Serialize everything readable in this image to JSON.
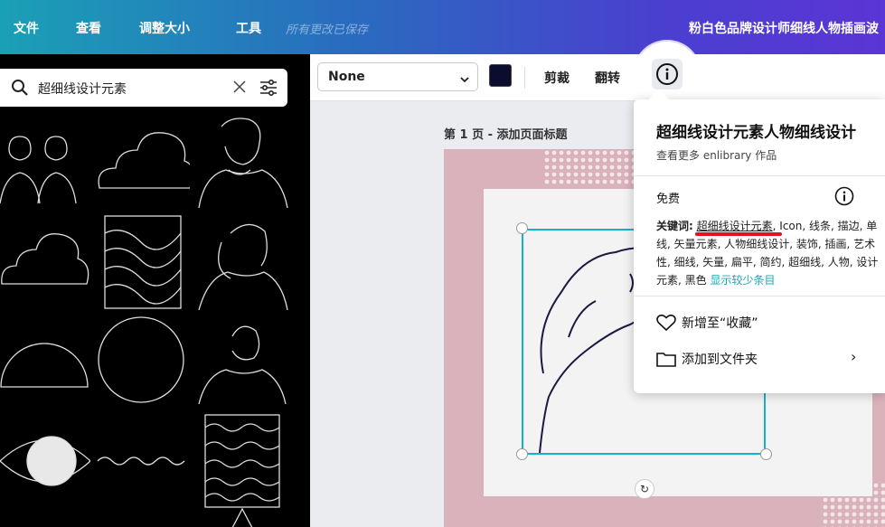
{
  "topbar": {
    "menu": [
      "文件",
      "查看",
      "调整大小",
      "工具"
    ],
    "saved_status": "所有更改已保存",
    "doc_title": "粉白色品牌设计师细线人物插画波"
  },
  "search": {
    "value": "超细线设计元素",
    "icon": "search-icon",
    "clear_icon": "close-icon",
    "filter_icon": "filter-icon"
  },
  "toolbar": {
    "font_value": "None",
    "color": "#0b0d2e",
    "crop_label": "剪裁",
    "flip_label": "翻转",
    "info_icon": "info-icon"
  },
  "canvas": {
    "page_label": "第 1 页 - 添加页面标题",
    "page_color": "#d9b2bb"
  },
  "popup": {
    "title": "超细线设计元素人物细线设计",
    "author": "查看更多 enlibrary 作品",
    "license": "免费",
    "keywords_label": "关键词:",
    "keywords_highlight": "超细线设计元素",
    "keywords_rest": ", Icon, 线条, 描边, 单线, 矢量元素, 人物细线设计, 装饰, 插画, 艺术性, 细线, 矢量, 扁平, 简约, 超细线, 人物, 设计元素, 黑色 ",
    "show_less": "显示较少条目",
    "add_favorite": "新增至“收藏”",
    "add_folder": "添加到文件夹"
  },
  "colors": {
    "accent": "#16b2c4",
    "highlight_underline": "#e4121b"
  }
}
